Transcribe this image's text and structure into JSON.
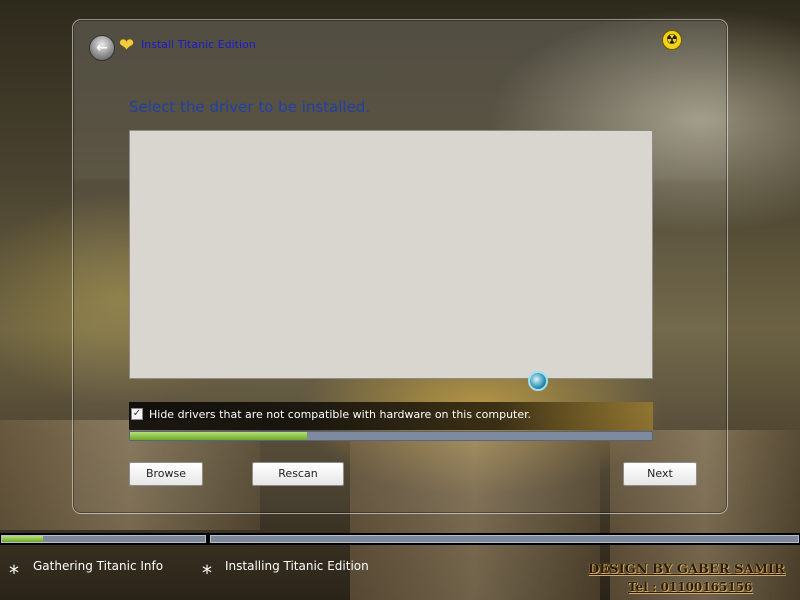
{
  "window": {
    "title": "Install Titanic Edition",
    "heading": "Select the driver to be installed.",
    "driver_list": [],
    "hide_incompatible": {
      "checked": true,
      "label": "Hide drivers that are not compatible with hardware on this computer."
    },
    "progress_fraction": 0.34,
    "buttons": {
      "browse": "Browse",
      "rescan": "Rescan",
      "next": "Next"
    },
    "icons": {
      "back": "back-arrow-icon",
      "title": "heart-icon",
      "corner": "radiation-icon"
    }
  },
  "bottom_bar": {
    "step1_progress_fraction": 0.2,
    "steps": [
      {
        "label": "Gathering Titanic Info"
      },
      {
        "label": "Installing Titanic Edition"
      }
    ]
  },
  "credits": {
    "design": "DESIGN BY GABER SAMIR",
    "tel": "Tel : 01100165156"
  },
  "colors": {
    "title_text": "#1a1ad0",
    "heading_text": "#2040a8",
    "progress_fill": "#6ca828",
    "progress_track": "#7d8aa0"
  }
}
